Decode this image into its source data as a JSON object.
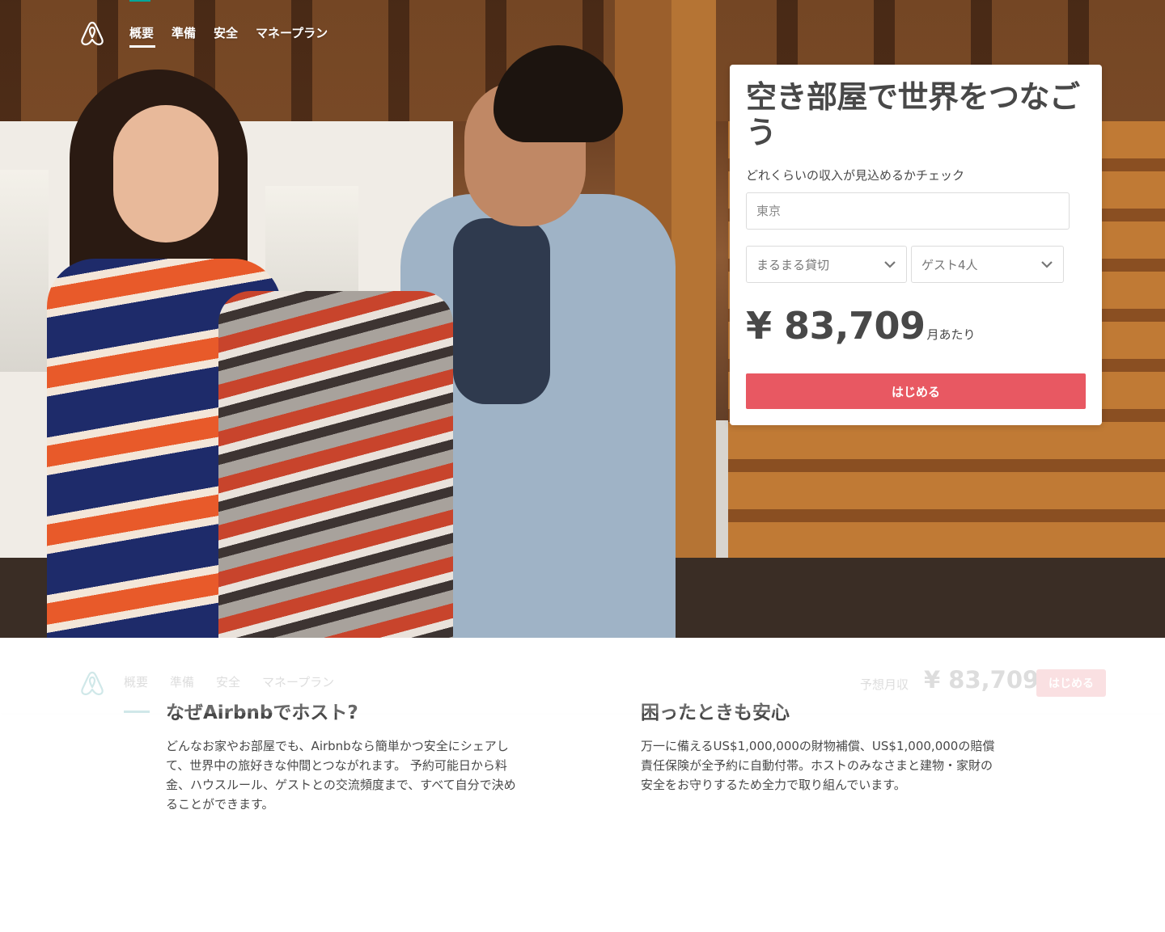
{
  "nav": {
    "items": [
      "概要",
      "準備",
      "安全",
      "マネープラン"
    ],
    "active": "概要"
  },
  "hero": {
    "title": "空き部屋で世界をつなごう",
    "subtitle": "どれくらいの収入が見込めるかチェック",
    "location_placeholder": "東京",
    "room_type": "まるまる貸切",
    "guests": "ゲスト4人",
    "price": "¥ 83,709",
    "price_unit": "月あたり",
    "cta": "はじめる"
  },
  "sticky": {
    "estimate_label": "予想月収",
    "estimate_value": "¥ 83,709",
    "cta": "はじめる"
  },
  "sections": [
    {
      "title": "なぜAirbnbでホスト?",
      "body": "どんなお家やお部屋でも、Airbnbなら簡単かつ安全にシェアして、世界中の旅好きな仲間とつながれます。 予約可能日から料金、ハウスルール、ゲストとの交流頻度まで、すべて自分で決めることができます。"
    },
    {
      "title": "困ったときも安心",
      "body": "万一に備えるUS$1,000,000の財物補償、US$1,000,000の賠償責任保険が全予約に自動付帯。ホストのみなさまと建物・家財の安全をお守りするため全力で取り組んでいます。"
    }
  ],
  "colors": {
    "brand": "#e85862",
    "teal": "#008489",
    "text": "#484848"
  },
  "icons": [
    "airbnb-logo-icon",
    "chevron-down-icon"
  ]
}
